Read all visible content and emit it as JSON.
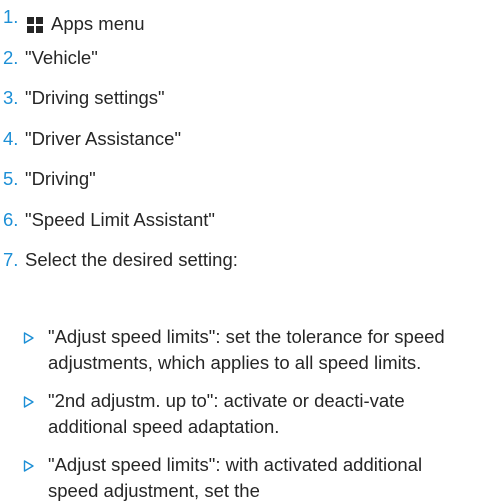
{
  "steps": [
    {
      "number": "1.",
      "text": "Apps menu",
      "icon": "apps-grid-icon"
    },
    {
      "number": "2.",
      "text": "\"Vehicle\""
    },
    {
      "number": "3.",
      "text": "\"Driving settings\""
    },
    {
      "number": "4.",
      "text": "\"Driver Assistance\""
    },
    {
      "number": "5.",
      "text": "\"Driving\""
    },
    {
      "number": "6.",
      "text": "\"Speed Limit Assistant\""
    },
    {
      "number": "7.",
      "text": "Select the desired setting:"
    }
  ],
  "substeps": [
    {
      "text": "\"Adjust speed limits\": set the tolerance for speed adjustments, which applies to all speed limits."
    },
    {
      "text": "\"2nd adjustm. up to\": activate or deacti-vate additional speed adaptation."
    },
    {
      "text": "\"Adjust speed limits\": with activated additional speed adjustment, set the"
    }
  ],
  "colors": {
    "accent": "#1c8fd6",
    "text": "#262626",
    "background": "#ffffff"
  },
  "bullet_icon": "triangle-right-outline-icon"
}
